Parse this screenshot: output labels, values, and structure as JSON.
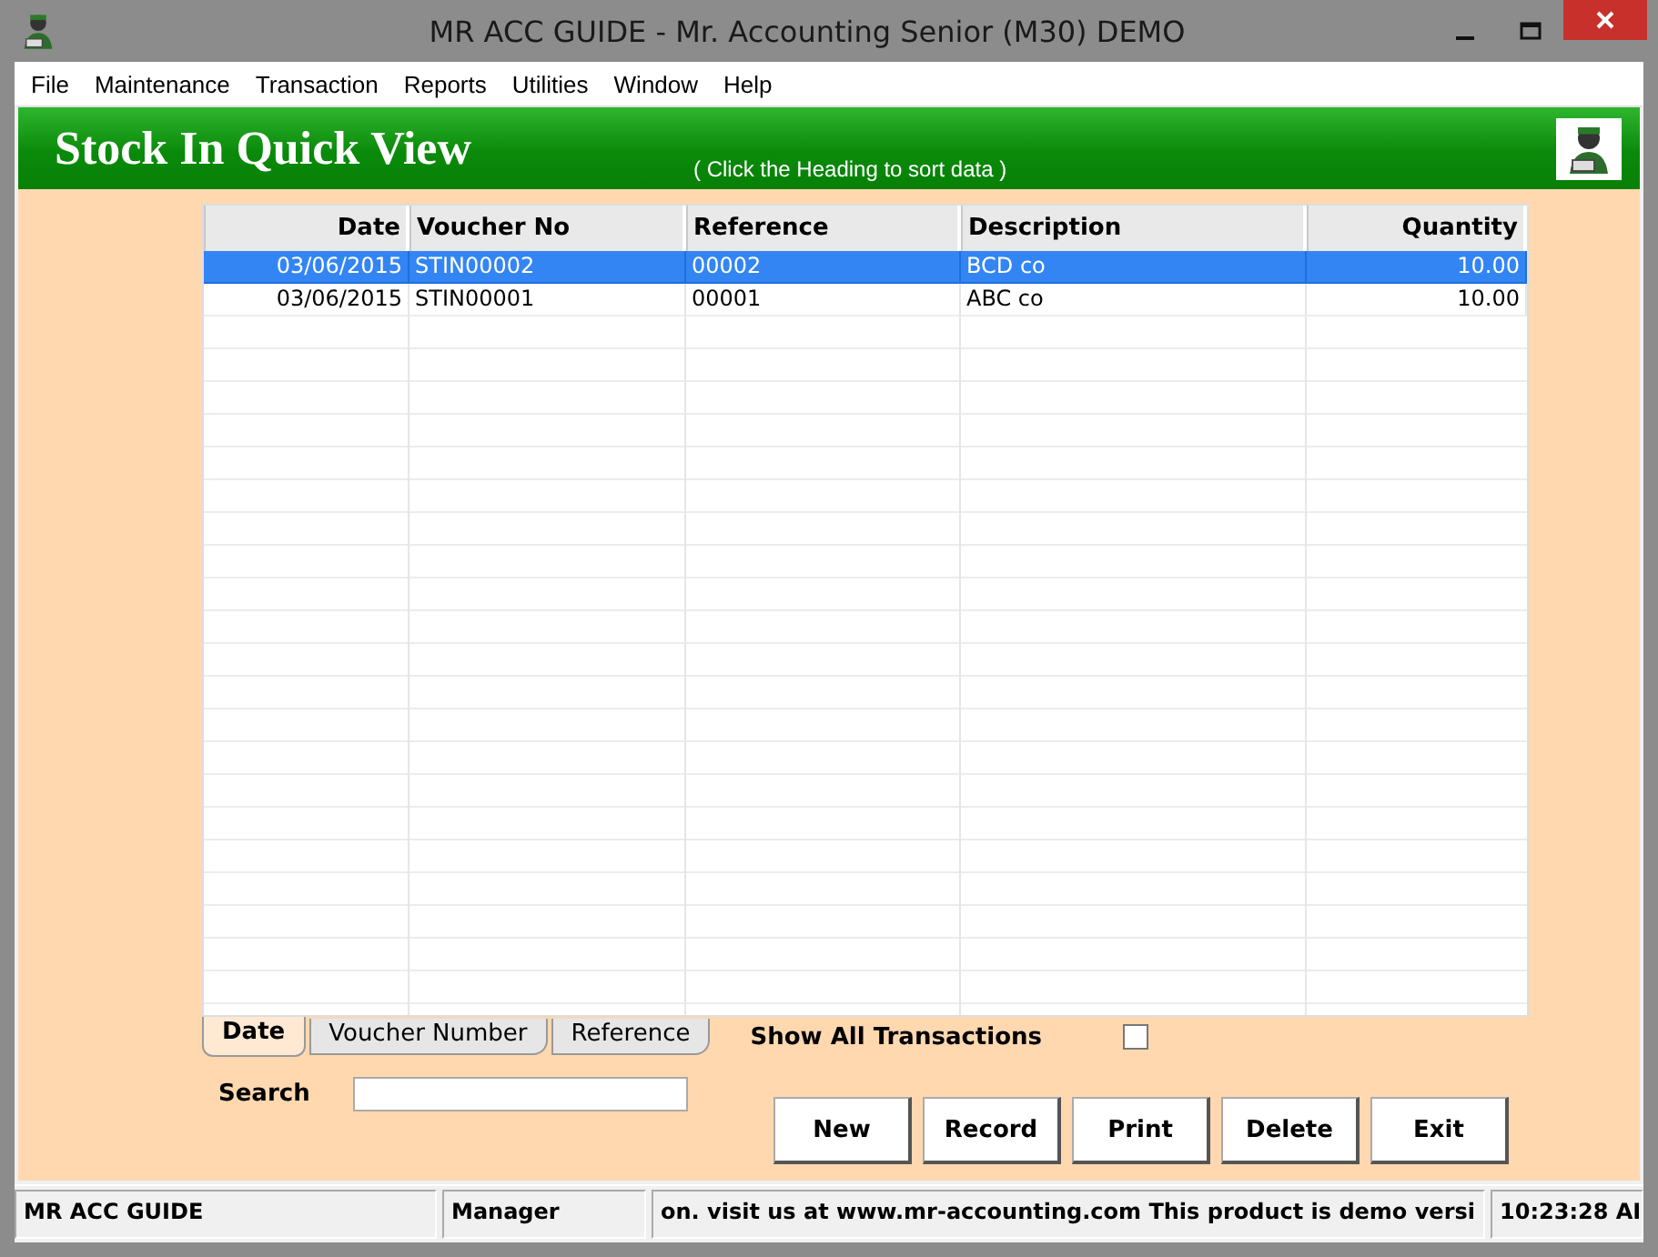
{
  "window": {
    "title": "MR ACC GUIDE - Mr. Accounting Senior (M30) DEMO"
  },
  "menu": [
    "File",
    "Maintenance",
    "Transaction",
    "Reports",
    "Utilities",
    "Window",
    "Help"
  ],
  "header": {
    "title": "Stock In Quick View",
    "hint": "( Click the Heading to sort data )"
  },
  "table": {
    "columns": [
      "Date",
      "Voucher No",
      "Reference",
      "Description",
      "Quantity"
    ],
    "rows": [
      {
        "cells": [
          "03/06/2015",
          "STIN00002",
          "00002",
          "BCD co",
          "10.00"
        ],
        "selected": true
      },
      {
        "cells": [
          "03/06/2015",
          "STIN00001",
          "00001",
          "ABC co",
          "10.00"
        ],
        "selected": false
      }
    ]
  },
  "sort_tabs": [
    {
      "label": "Date",
      "selected": true
    },
    {
      "label": "Voucher Number",
      "selected": false
    },
    {
      "label": "Reference",
      "selected": false
    }
  ],
  "show_all": {
    "label": "Show All Transactions",
    "checked": false
  },
  "search": {
    "label": "Search"
  },
  "buttons": [
    "New",
    "Record",
    "Print",
    "Delete",
    "Exit"
  ],
  "status_bar": [
    "MR ACC GUIDE",
    "Manager",
    "on.  visit us at www.mr-accounting.com This product is demo versi",
    "10:23:28 AI"
  ]
}
